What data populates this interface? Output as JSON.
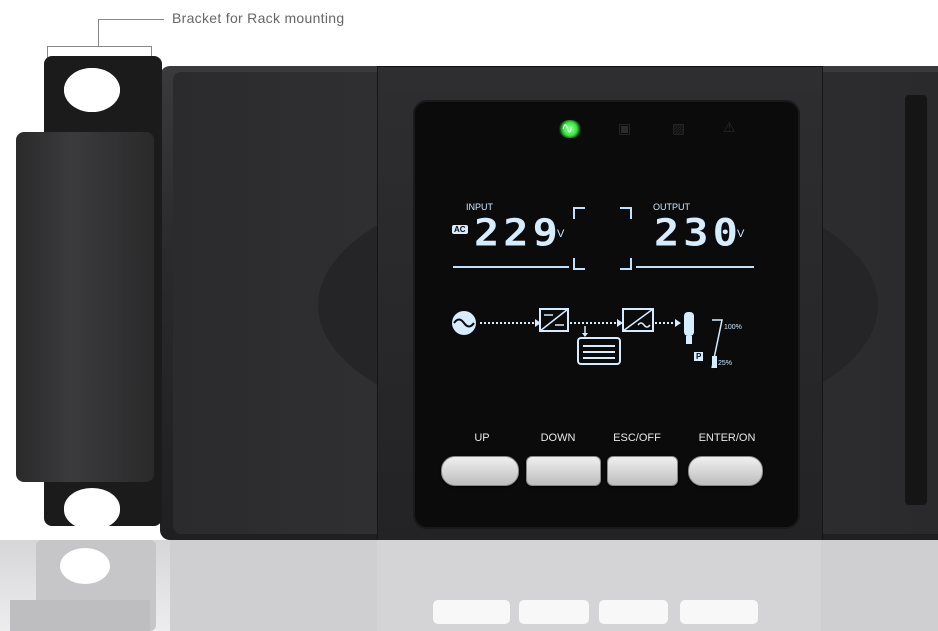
{
  "callout": {
    "text": "Bracket for Rack mounting"
  },
  "lcd": {
    "input_label": "INPUT",
    "output_label": "OUTPUT",
    "ac_badge": "AC",
    "input_voltage": "229",
    "output_voltage": "230",
    "unit": "V",
    "load_max": "100%",
    "load_min": "25%",
    "p_badge": "P"
  },
  "buttons": [
    {
      "label": "UP"
    },
    {
      "label": "DOWN"
    },
    {
      "label": "ESC/OFF"
    },
    {
      "label": "ENTER/ON"
    }
  ],
  "status_icons": [
    "ac-wave-icon",
    "battery-icon",
    "bypass-icon",
    "warning-icon"
  ],
  "colors": {
    "lcd_text": "#d6ecff",
    "led_green": "#33e83c",
    "chassis": "#2a2a2c"
  }
}
